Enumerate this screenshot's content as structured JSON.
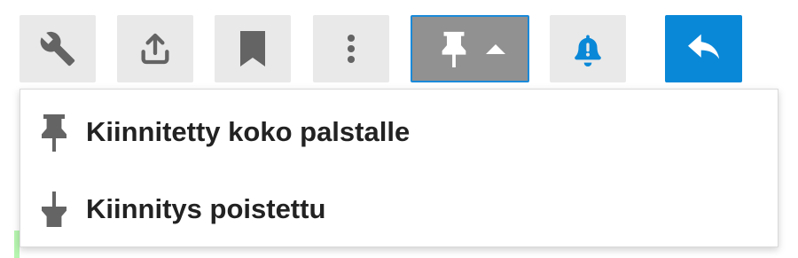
{
  "toolbar": {
    "buttons": [
      {
        "id": "wrench",
        "icon": "wrench-icon"
      },
      {
        "id": "share",
        "icon": "share-icon"
      },
      {
        "id": "bookmark",
        "icon": "bookmark-icon"
      },
      {
        "id": "more",
        "icon": "more-vertical-icon"
      },
      {
        "id": "pin",
        "icon": "pin-icon",
        "caret": "caret-up-icon",
        "state": "open"
      },
      {
        "id": "notifications",
        "icon": "bell-icon"
      },
      {
        "id": "reply",
        "icon": "reply-icon"
      }
    ]
  },
  "pin_menu": {
    "items": [
      {
        "label": "Kiinnitetty koko palstalle",
        "icon": "pin-icon"
      },
      {
        "label": "Kiinnitys poistettu",
        "icon": "unpin-icon"
      }
    ]
  },
  "colors": {
    "button_bg": "#e9e9e9",
    "icon_gray": "#646464",
    "active_button_bg": "#919191",
    "active_border": "#1a8ad9",
    "accent_blue": "#0a88d8",
    "menu_text": "#222222"
  }
}
